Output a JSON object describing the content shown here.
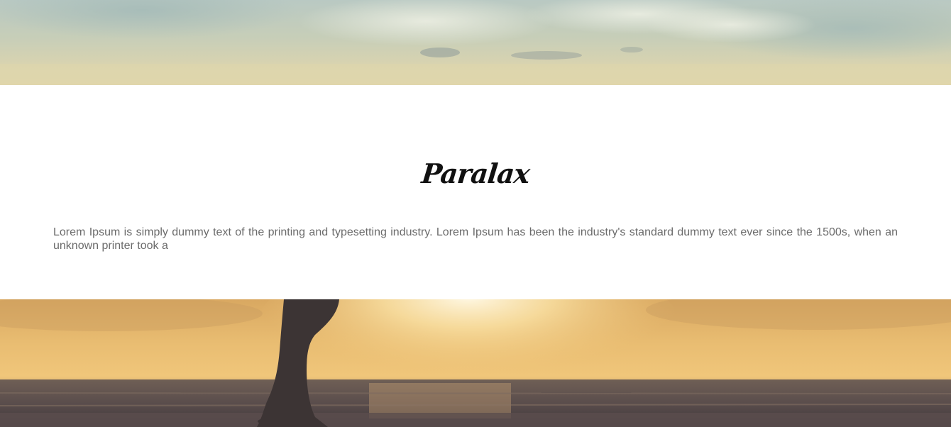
{
  "section": {
    "title": "Paralax",
    "body": "Lorem Ipsum is simply dummy text of the printing and typesetting industry. Lorem Ipsum has been the industry's standard dummy text ever since the 1500s, when an unknown printer took a"
  },
  "images": {
    "top": "sky-clouds-image",
    "bottom": "beach-sunset-walker-image"
  },
  "colors": {
    "title": "#111111",
    "body_text": "#6b6b6b",
    "background": "#ffffff"
  }
}
